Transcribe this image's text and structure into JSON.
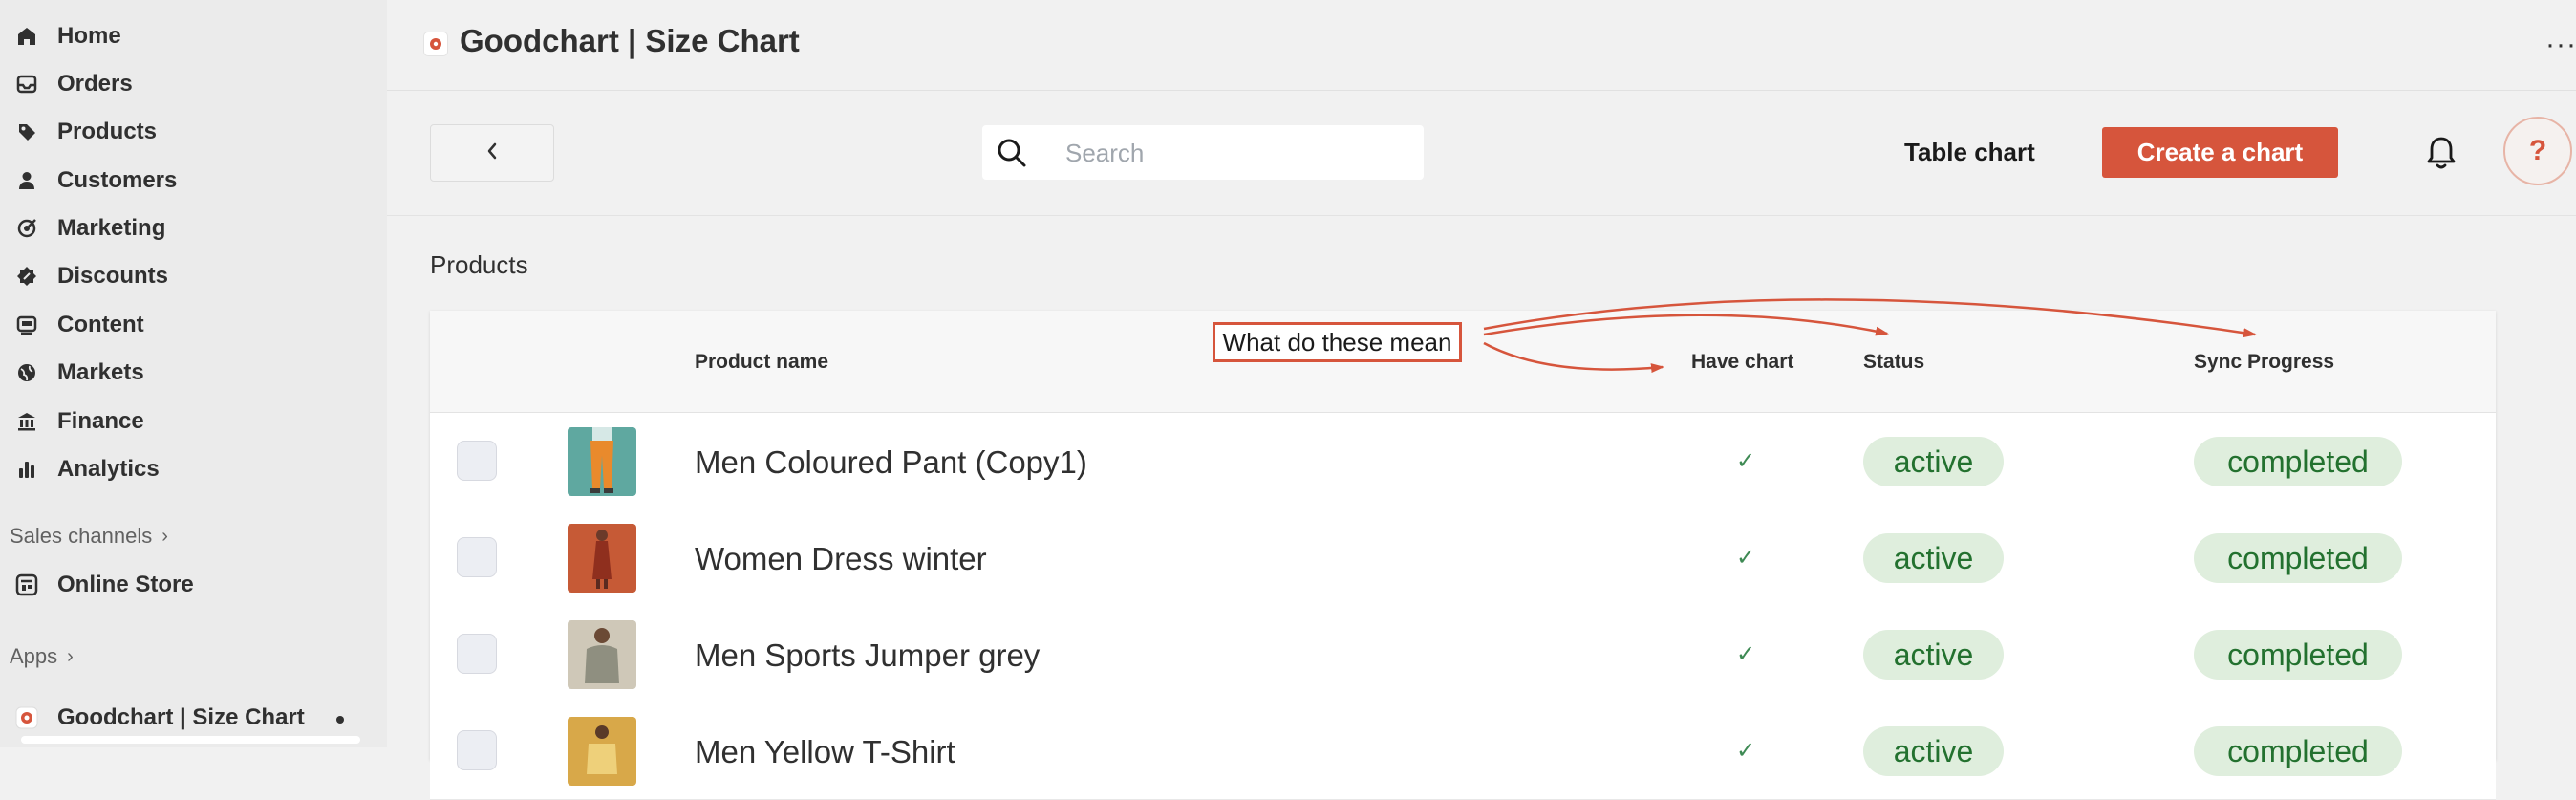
{
  "sidebar": {
    "items": [
      {
        "label": "Home",
        "icon": "home-icon"
      },
      {
        "label": "Orders",
        "icon": "inbox-icon"
      },
      {
        "label": "Products",
        "icon": "tag-icon"
      },
      {
        "label": "Customers",
        "icon": "person-icon"
      },
      {
        "label": "Marketing",
        "icon": "target-icon"
      },
      {
        "label": "Discounts",
        "icon": "discount-icon"
      },
      {
        "label": "Content",
        "icon": "content-icon"
      },
      {
        "label": "Markets",
        "icon": "globe-icon"
      },
      {
        "label": "Finance",
        "icon": "bank-icon"
      },
      {
        "label": "Analytics",
        "icon": "bar-chart-icon"
      }
    ],
    "sales_channels_label": "Sales channels",
    "online_store_label": "Online Store",
    "apps_label": "Apps",
    "app_item_label": "Goodchart | Size Chart"
  },
  "header": {
    "title": "Goodchart | Size Chart",
    "more_icon": "more-horizontal-icon"
  },
  "toolbar": {
    "search_placeholder": "Search",
    "table_chart_label": "Table chart",
    "create_label": "Create a chart",
    "help_label": "?",
    "accent_color": "#d6553c"
  },
  "page": {
    "heading": "Products"
  },
  "table": {
    "headers": {
      "product_name": "Product name",
      "have_chart": "Have chart",
      "status": "Status",
      "sync_progress": "Sync Progress"
    },
    "rows": [
      {
        "name": "Men Coloured Pant (Copy1)",
        "have_chart": "✓",
        "status": "active",
        "sync": "completed"
      },
      {
        "name": "Women Dress winter",
        "have_chart": "✓",
        "status": "active",
        "sync": "completed"
      },
      {
        "name": "Men Sports Jumper grey",
        "have_chart": "✓",
        "status": "active",
        "sync": "completed"
      },
      {
        "name": "Men Yellow T-Shirt",
        "have_chart": "✓",
        "status": "active",
        "sync": "completed"
      }
    ]
  },
  "annotation": {
    "text": "What do these mean",
    "color": "#d6553c"
  }
}
